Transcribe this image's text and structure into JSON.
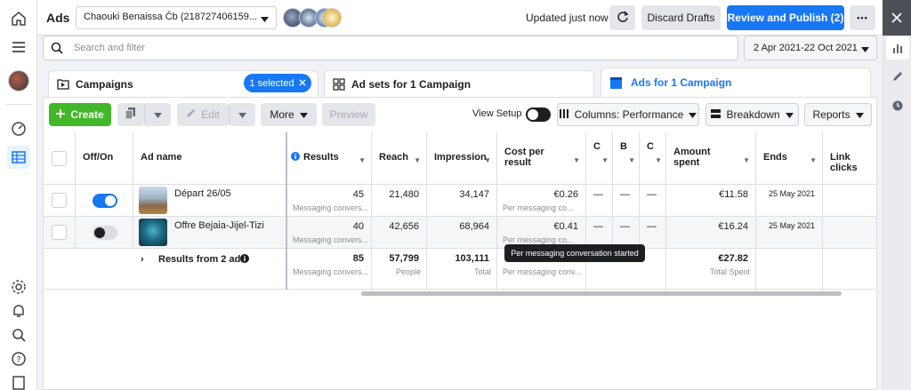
{
  "topbar": {
    "title": "Ads",
    "account": "Chaouki Benaissa Čb (218727406159...",
    "status": "Updated just now",
    "discard_label": "Discard Drafts",
    "publish_label": "Review and Publish (2)",
    "more_label": "•••"
  },
  "search": {
    "placeholder": "Search and filter",
    "date_range": "2 Apr 2021-22 Oct 2021"
  },
  "tabs": {
    "campaigns": "Campaigns",
    "selected_chip": "1 selected",
    "adsets": "Ad sets for 1 Campaign",
    "ads": "Ads for 1 Campaign"
  },
  "toolbar": {
    "create": "Create",
    "edit": "Edit",
    "more": "More",
    "preview": "Preview",
    "view_setup": "View Setup",
    "columns": "Columns: Performance",
    "breakdown": "Breakdown",
    "reports": "Reports"
  },
  "table": {
    "headers": {
      "onoff": "Off/On",
      "adname": "Ad name",
      "results": "Results",
      "reach": "Reach",
      "impression": "Impression",
      "cpr": "Cost per result",
      "c1": "C",
      "c2": "B",
      "c3": "C",
      "amount": "Amount spent",
      "ends": "Ends",
      "link": "Link clicks"
    },
    "rows": [
      {
        "name": "Départ 26/05",
        "on": true,
        "results": "45",
        "results_sub": "Messaging convers...",
        "reach": "21,480",
        "impression": "34,147",
        "cpr": "€0.26",
        "cpr_sub": "Per messaging co...",
        "dash": "—",
        "amount": "€11.58",
        "ends": "25 May 2021"
      },
      {
        "name": "Offre Bejaia-Jijel-Tizi",
        "on": false,
        "results": "40",
        "results_sub": "Messaging convers...",
        "reach": "42,656",
        "impression": "68,964",
        "cpr": "€0.41",
        "cpr_sub": "Per messaging co...",
        "dash": "—",
        "amount": "€16.24",
        "ends": "25 May 2021"
      }
    ],
    "summary": {
      "label": "Results from 2 ads",
      "results": "85",
      "results_sub": "Messaging convers...",
      "reach": "57,799",
      "reach_sub": "People",
      "impression": "103,111",
      "impression_sub": "Total",
      "cpr_sub": "Per messaging conv...",
      "amount": "€27.82",
      "amount_sub": "Total Spent"
    }
  },
  "tooltip": "Per messaging conversation started",
  "colors": {
    "accent": "#1877f2",
    "create": "#42b72a"
  }
}
